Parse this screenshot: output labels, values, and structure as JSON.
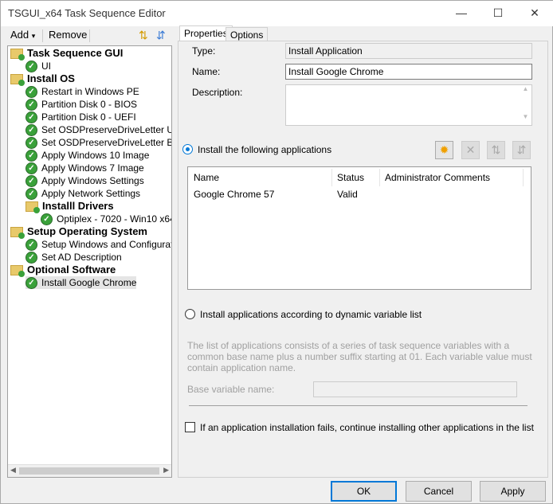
{
  "window": {
    "title": "TSGUI_x64 Task Sequence Editor",
    "minimize": "—",
    "maximize": "☐",
    "close": "✕"
  },
  "toolbar": {
    "add": "Add",
    "add_arrow": "▾",
    "remove": "Remove"
  },
  "tree": [
    {
      "label": "Task Sequence GUI",
      "type": "group",
      "level": 0
    },
    {
      "label": "UI",
      "type": "step",
      "level": 1
    },
    {
      "label": "Install OS",
      "type": "group",
      "level": 0
    },
    {
      "label": "Restart in Windows PE",
      "type": "step",
      "level": 1
    },
    {
      "label": "Partition Disk 0 - BIOS",
      "type": "step",
      "level": 1
    },
    {
      "label": "Partition Disk 0 - UEFI",
      "type": "step",
      "level": 1
    },
    {
      "label": "Set OSDPreserveDriveLetter UEFI",
      "type": "step",
      "level": 1
    },
    {
      "label": "Set OSDPreserveDriveLetter BIOS",
      "type": "step",
      "level": 1
    },
    {
      "label": "Apply Windows 10 Image",
      "type": "step",
      "level": 1
    },
    {
      "label": "Apply Windows 7 Image",
      "type": "step",
      "level": 1
    },
    {
      "label": "Apply Windows Settings",
      "type": "step",
      "level": 1
    },
    {
      "label": "Apply Network Settings",
      "type": "step",
      "level": 1
    },
    {
      "label": "Installl Drivers",
      "type": "group",
      "level": 1
    },
    {
      "label": "Optiplex - 7020 - Win10 x64",
      "type": "step",
      "level": 2
    },
    {
      "label": "Setup Operating System",
      "type": "group",
      "level": 0
    },
    {
      "label": "Setup Windows and Configuration",
      "type": "step",
      "level": 1
    },
    {
      "label": "Set AD Description",
      "type": "step",
      "level": 1
    },
    {
      "label": "Optional Software",
      "type": "group",
      "level": 0
    },
    {
      "label": "Install Google Chrome",
      "type": "step",
      "level": 1,
      "selected": true
    }
  ],
  "tabs": {
    "properties": "Properties",
    "options": "Options",
    "active": "properties"
  },
  "props": {
    "type_label": "Type:",
    "type_value": "Install Application",
    "name_label": "Name:",
    "name_value": "Install Google Chrome",
    "desc_label": "Description:",
    "desc_value": "",
    "radio1": "Install the following applications",
    "radio2": "Install applications according to dynamic variable list",
    "selected_radio": 1,
    "columns": [
      "Name",
      "Status",
      "Administrator Comments"
    ],
    "apps": [
      {
        "name": "Google Chrome 57",
        "status": "Valid",
        "comments": ""
      }
    ],
    "info": "The list of applications consists of a series of task sequence variables with a common base name plus a number suffix starting at 01. Each variable value must contain application name.",
    "base_label": "Base variable name:",
    "base_value": "",
    "continue_label": "If an application installation fails, continue installing other applications in the list",
    "continue_checked": false
  },
  "buttons": {
    "ok": "OK",
    "cancel": "Cancel",
    "apply": "Apply"
  }
}
